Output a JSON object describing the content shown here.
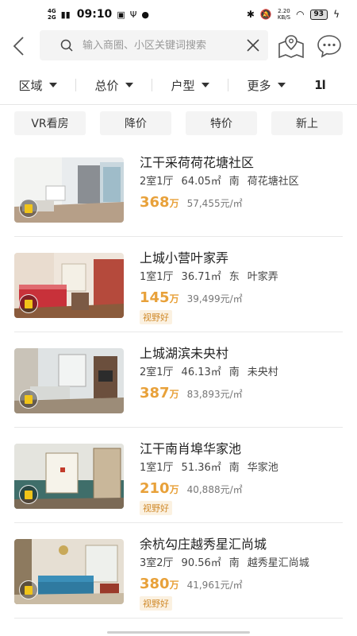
{
  "status_bar": {
    "network_top": "4G",
    "network_bottom": "2G",
    "time": "09:10",
    "speed_value": "2.20",
    "speed_unit": "KB/S",
    "battery": "93"
  },
  "header": {
    "search_placeholder": "输入商圈、小区关键词搜索"
  },
  "filters": [
    {
      "label": "区域"
    },
    {
      "label": "总价"
    },
    {
      "label": "户型"
    },
    {
      "label": "更多"
    }
  ],
  "sort_label": "1l",
  "chips": [
    "VR看房",
    "降价",
    "特价",
    "新上"
  ],
  "listings": [
    {
      "title": "江干采荷荷花塘社区",
      "layout": "2室1厅",
      "area": "64.05㎡",
      "orientation": "南",
      "community": "荷花塘社区",
      "price": "368",
      "price_unit": "万",
      "unit_price": "57,455元/㎡",
      "tag": ""
    },
    {
      "title": "上城小营叶家弄",
      "layout": "1室1厅",
      "area": "36.71㎡",
      "orientation": "东",
      "community": "叶家弄",
      "price": "145",
      "price_unit": "万",
      "unit_price": "39,499元/㎡",
      "tag": "视野好"
    },
    {
      "title": "上城湖滨未央村",
      "layout": "2室1厅",
      "area": "46.13㎡",
      "orientation": "南",
      "community": "未央村",
      "price": "387",
      "price_unit": "万",
      "unit_price": "83,893元/㎡",
      "tag": ""
    },
    {
      "title": "江干南肖埠华家池",
      "layout": "1室1厅",
      "area": "51.36㎡",
      "orientation": "南",
      "community": "华家池",
      "price": "210",
      "price_unit": "万",
      "unit_price": "40,888元/㎡",
      "tag": "视野好"
    },
    {
      "title": "余杭勾庄越秀星汇尚城",
      "layout": "3室2厅",
      "area": "90.56㎡",
      "orientation": "南",
      "community": "越秀星汇尚城",
      "price": "380",
      "price_unit": "万",
      "unit_price": "41,961元/㎡",
      "tag": "视野好"
    }
  ],
  "colors": {
    "price": "#e8a13a",
    "tag_bg": "#fbf1e1",
    "tag_text": "#d08a2a",
    "chip_bg": "#f4f4f4"
  }
}
